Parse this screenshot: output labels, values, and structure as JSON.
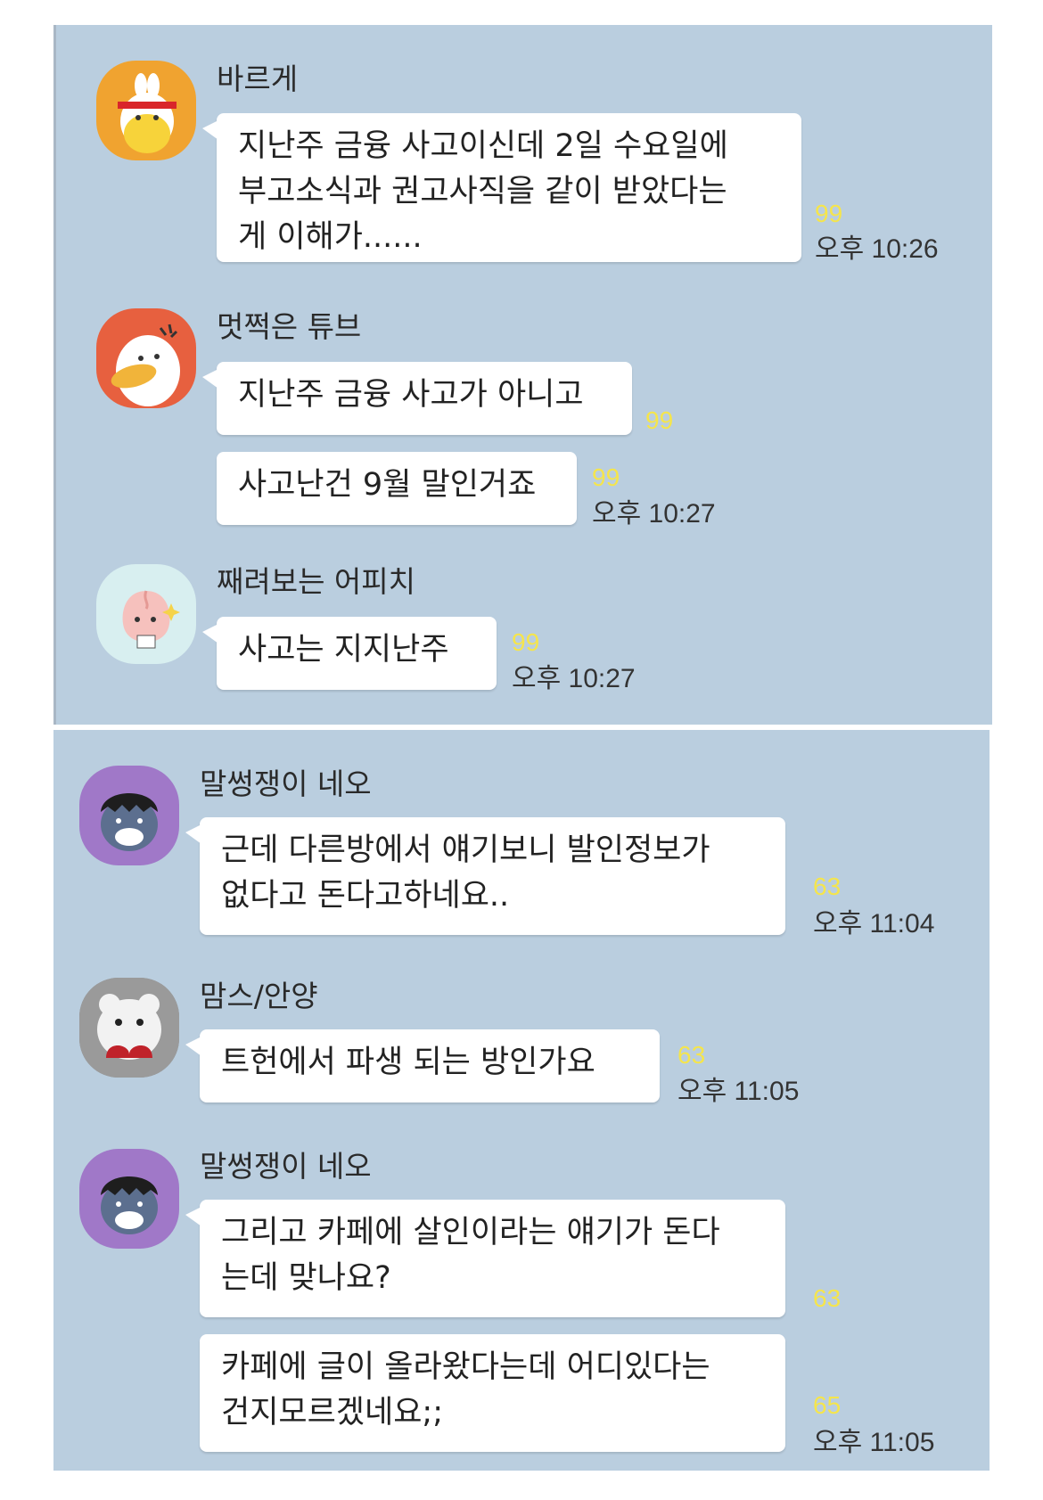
{
  "colors": {
    "background": "#bacedf",
    "bubble": "#ffffff",
    "unread": "#f5e54c"
  },
  "panel1": {
    "messages": [
      {
        "sender": "바르게",
        "avatar": "ryan-avatar-icon",
        "bubbles": [
          {
            "text": "지난주 금융 사고이신데 2일 수요일에\n부고소식과 권고사직을 같이 받았다는\n게 이해가......",
            "unread": "99",
            "time": "오후 10:26"
          }
        ]
      },
      {
        "sender": "멋쩍은 튜브",
        "avatar": "tube-avatar-icon",
        "bubbles": [
          {
            "text": "지난주 금융 사고가 아니고",
            "unread": "99",
            "time": ""
          },
          {
            "text": "사고난건 9월 말인거죠",
            "unread": "99",
            "time": "오후 10:27"
          }
        ]
      },
      {
        "sender": "째려보는 어피치",
        "avatar": "apeach-avatar-icon",
        "bubbles": [
          {
            "text": "사고는 지지난주",
            "unread": "99",
            "time": "오후 10:27"
          }
        ]
      }
    ]
  },
  "panel2": {
    "messages": [
      {
        "sender": "말썽쟁이 네오",
        "avatar": "neo-avatar-icon",
        "bubbles": [
          {
            "text": "근데 다른방에서 얘기보니 발인정보가\n없다고 돈다고하네요..",
            "unread": "63",
            "time": "오후 11:04"
          }
        ]
      },
      {
        "sender": "맘스/안양",
        "avatar": "bear-photo-avatar",
        "bubbles": [
          {
            "text": "트헌에서 파생 되는 방인가요",
            "unread": "63",
            "time": "오후 11:05"
          }
        ]
      },
      {
        "sender": "말썽쟁이 네오",
        "avatar": "neo-avatar-icon",
        "bubbles": [
          {
            "text": "그리고 카페에 살인이라는 얘기가 돈다\n는데 맞나요?",
            "unread": "63",
            "time": ""
          },
          {
            "text": "카페에 글이 올라왔다는데 어디있다는\n건지모르겠네요;;",
            "unread": "65",
            "time": "오후 11:05"
          }
        ]
      }
    ]
  }
}
